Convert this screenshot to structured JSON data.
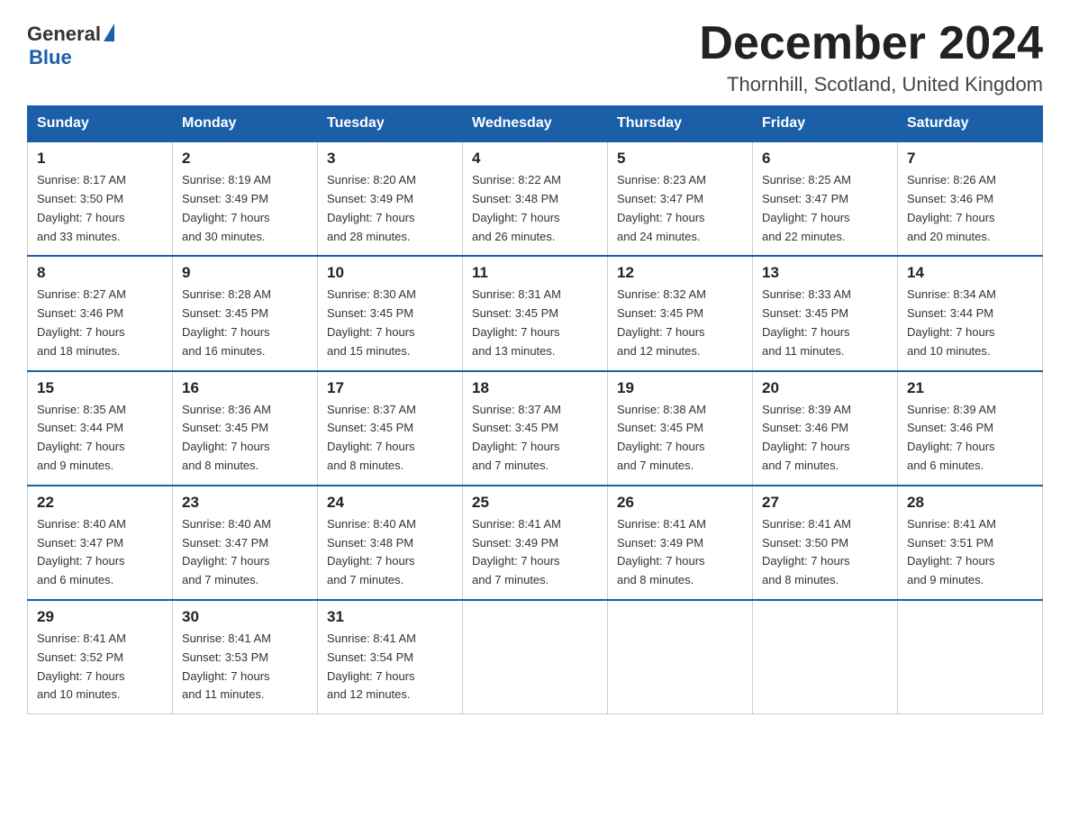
{
  "header": {
    "logo_general": "General",
    "logo_blue": "Blue",
    "month_title": "December 2024",
    "location": "Thornhill, Scotland, United Kingdom"
  },
  "days_of_week": [
    "Sunday",
    "Monday",
    "Tuesday",
    "Wednesday",
    "Thursday",
    "Friday",
    "Saturday"
  ],
  "weeks": [
    [
      {
        "day": "1",
        "sunrise": "8:17 AM",
        "sunset": "3:50 PM",
        "daylight": "7 hours and 33 minutes."
      },
      {
        "day": "2",
        "sunrise": "8:19 AM",
        "sunset": "3:49 PM",
        "daylight": "7 hours and 30 minutes."
      },
      {
        "day": "3",
        "sunrise": "8:20 AM",
        "sunset": "3:49 PM",
        "daylight": "7 hours and 28 minutes."
      },
      {
        "day": "4",
        "sunrise": "8:22 AM",
        "sunset": "3:48 PM",
        "daylight": "7 hours and 26 minutes."
      },
      {
        "day": "5",
        "sunrise": "8:23 AM",
        "sunset": "3:47 PM",
        "daylight": "7 hours and 24 minutes."
      },
      {
        "day": "6",
        "sunrise": "8:25 AM",
        "sunset": "3:47 PM",
        "daylight": "7 hours and 22 minutes."
      },
      {
        "day": "7",
        "sunrise": "8:26 AM",
        "sunset": "3:46 PM",
        "daylight": "7 hours and 20 minutes."
      }
    ],
    [
      {
        "day": "8",
        "sunrise": "8:27 AM",
        "sunset": "3:46 PM",
        "daylight": "7 hours and 18 minutes."
      },
      {
        "day": "9",
        "sunrise": "8:28 AM",
        "sunset": "3:45 PM",
        "daylight": "7 hours and 16 minutes."
      },
      {
        "day": "10",
        "sunrise": "8:30 AM",
        "sunset": "3:45 PM",
        "daylight": "7 hours and 15 minutes."
      },
      {
        "day": "11",
        "sunrise": "8:31 AM",
        "sunset": "3:45 PM",
        "daylight": "7 hours and 13 minutes."
      },
      {
        "day": "12",
        "sunrise": "8:32 AM",
        "sunset": "3:45 PM",
        "daylight": "7 hours and 12 minutes."
      },
      {
        "day": "13",
        "sunrise": "8:33 AM",
        "sunset": "3:45 PM",
        "daylight": "7 hours and 11 minutes."
      },
      {
        "day": "14",
        "sunrise": "8:34 AM",
        "sunset": "3:44 PM",
        "daylight": "7 hours and 10 minutes."
      }
    ],
    [
      {
        "day": "15",
        "sunrise": "8:35 AM",
        "sunset": "3:44 PM",
        "daylight": "7 hours and 9 minutes."
      },
      {
        "day": "16",
        "sunrise": "8:36 AM",
        "sunset": "3:45 PM",
        "daylight": "7 hours and 8 minutes."
      },
      {
        "day": "17",
        "sunrise": "8:37 AM",
        "sunset": "3:45 PM",
        "daylight": "7 hours and 8 minutes."
      },
      {
        "day": "18",
        "sunrise": "8:37 AM",
        "sunset": "3:45 PM",
        "daylight": "7 hours and 7 minutes."
      },
      {
        "day": "19",
        "sunrise": "8:38 AM",
        "sunset": "3:45 PM",
        "daylight": "7 hours and 7 minutes."
      },
      {
        "day": "20",
        "sunrise": "8:39 AM",
        "sunset": "3:46 PM",
        "daylight": "7 hours and 7 minutes."
      },
      {
        "day": "21",
        "sunrise": "8:39 AM",
        "sunset": "3:46 PM",
        "daylight": "7 hours and 6 minutes."
      }
    ],
    [
      {
        "day": "22",
        "sunrise": "8:40 AM",
        "sunset": "3:47 PM",
        "daylight": "7 hours and 6 minutes."
      },
      {
        "day": "23",
        "sunrise": "8:40 AM",
        "sunset": "3:47 PM",
        "daylight": "7 hours and 7 minutes."
      },
      {
        "day": "24",
        "sunrise": "8:40 AM",
        "sunset": "3:48 PM",
        "daylight": "7 hours and 7 minutes."
      },
      {
        "day": "25",
        "sunrise": "8:41 AM",
        "sunset": "3:49 PM",
        "daylight": "7 hours and 7 minutes."
      },
      {
        "day": "26",
        "sunrise": "8:41 AM",
        "sunset": "3:49 PM",
        "daylight": "7 hours and 8 minutes."
      },
      {
        "day": "27",
        "sunrise": "8:41 AM",
        "sunset": "3:50 PM",
        "daylight": "7 hours and 8 minutes."
      },
      {
        "day": "28",
        "sunrise": "8:41 AM",
        "sunset": "3:51 PM",
        "daylight": "7 hours and 9 minutes."
      }
    ],
    [
      {
        "day": "29",
        "sunrise": "8:41 AM",
        "sunset": "3:52 PM",
        "daylight": "7 hours and 10 minutes."
      },
      {
        "day": "30",
        "sunrise": "8:41 AM",
        "sunset": "3:53 PM",
        "daylight": "7 hours and 11 minutes."
      },
      {
        "day": "31",
        "sunrise": "8:41 AM",
        "sunset": "3:54 PM",
        "daylight": "7 hours and 12 minutes."
      },
      null,
      null,
      null,
      null
    ]
  ],
  "labels": {
    "sunrise": "Sunrise:",
    "sunset": "Sunset:",
    "daylight": "Daylight:"
  }
}
